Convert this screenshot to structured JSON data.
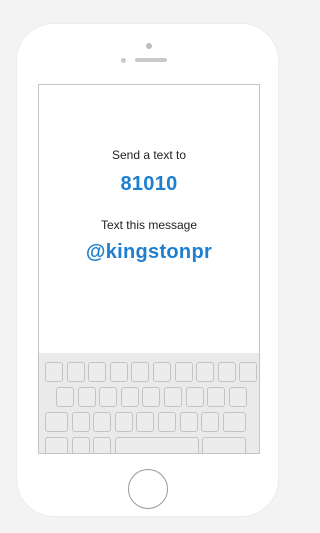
{
  "screen": {
    "send_label": "Send a text to",
    "shortcode": "81010",
    "message_label": "Text this message",
    "keyword": "@kingstonpr"
  },
  "colors": {
    "accent": "#1e7fd0",
    "text": "#222222",
    "outline": "#c4c4c4",
    "keyboard_bg": "#eaeaea"
  },
  "keyboard": {
    "rows": [
      {
        "keys": [
          "key",
          "key",
          "key",
          "key",
          "key",
          "key",
          "key",
          "key",
          "key",
          "key"
        ]
      },
      {
        "keys": [
          "key",
          "key",
          "key",
          "key",
          "key",
          "key",
          "key",
          "key",
          "key"
        ]
      },
      {
        "keys": [
          "shift-key",
          "key",
          "key",
          "key",
          "key",
          "key",
          "key",
          "key",
          "backspace-key"
        ]
      },
      {
        "keys": [
          "numbers-key",
          "globe-key",
          "mic-key",
          "space-key",
          "return-key"
        ]
      }
    ]
  }
}
